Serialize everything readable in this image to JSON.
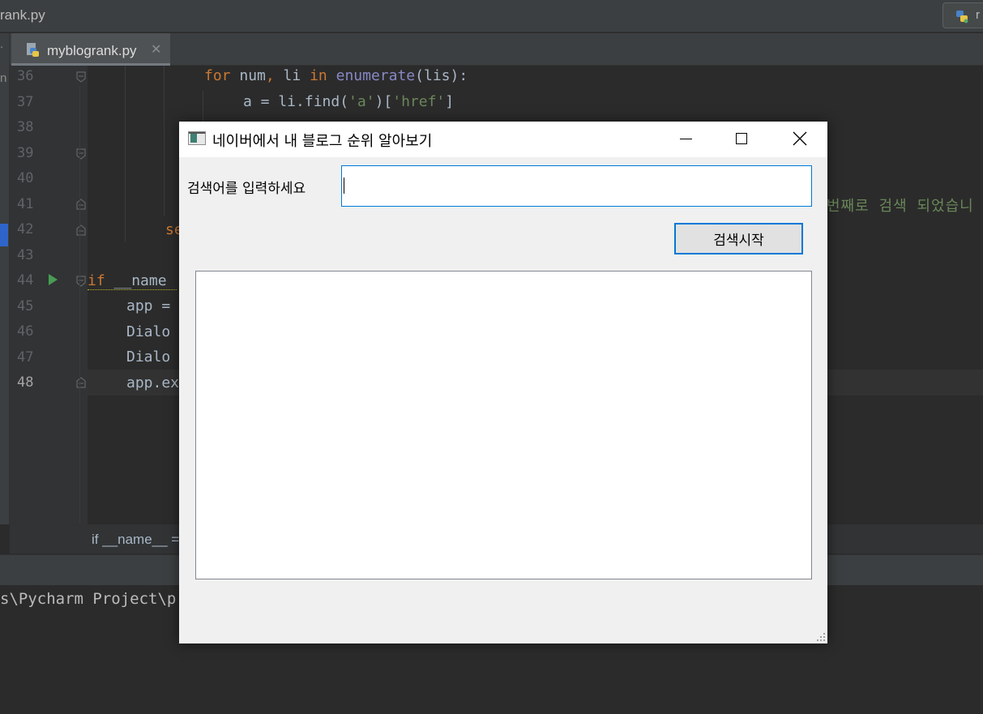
{
  "ide": {
    "window_title": "rank.py",
    "run_config_label": "r",
    "side_label": "n",
    "editor_tab": {
      "label": "myblogrank.py",
      "close": "✕"
    },
    "line_numbers": [
      "36",
      "37",
      "38",
      "39",
      "40",
      "41",
      "42",
      "43",
      "44",
      "45",
      "46",
      "47",
      "48"
    ],
    "code": {
      "l36_for": "for",
      "l36_a": " num",
      "l36_comma": ",",
      "l36_b": " li ",
      "l36_in": "in",
      "l36_sp": " ",
      "l36_fn": "enumerate",
      "l36_c": "(lis):",
      "l37_a": "a = li.find(",
      "l37_s1": "'a'",
      "l37_b": ")[",
      "l37_s2": "'href'",
      "l37_c": "]",
      "l42": "se",
      "l44_kw": "if",
      "l44_rest": " __name",
      "l45": "app =",
      "l46": "Dialo",
      "l47": "Dialo",
      "l48": "app.ex"
    },
    "comment_fragment": "번째로 검색 되었습니",
    "breadcrumb": "if __name__ =",
    "terminal_line": "s\\Pycharm Project\\p"
  },
  "dialog": {
    "title": "네이버에서 내 블로그 순위 알아보기",
    "search_label": "검색어를 입력하세요",
    "search_value": "",
    "start_button": "검색시작",
    "result_text": ""
  },
  "colors": {
    "accent": "#0078d7",
    "ide_bg": "#2b2b2b",
    "keyword": "#cc7832",
    "string": "#6a8759"
  }
}
